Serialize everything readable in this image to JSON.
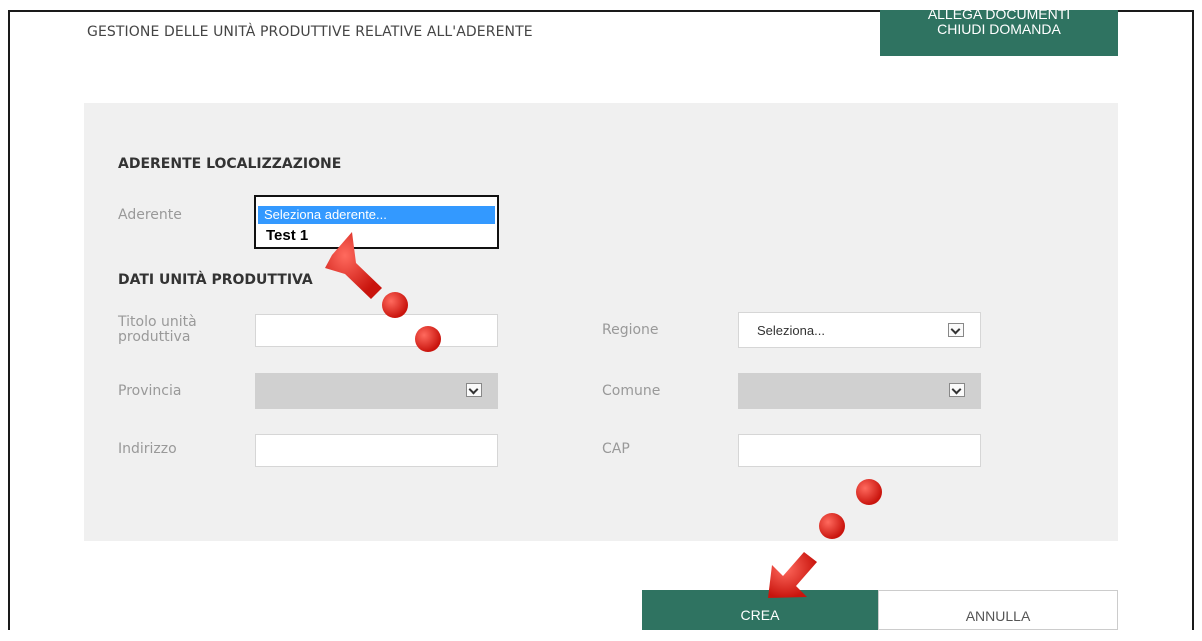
{
  "header": {
    "page_title": "GESTIONE DELLE UNITÀ PRODUTTIVE RELATIVE ALL'ADERENTE",
    "actions_line1": "ALLEGA DOCUMENTI",
    "actions_line2": "CHIUDI DOMANDA"
  },
  "aderente_section": {
    "title": "ADERENTE LOCALIZZAZIONE",
    "aderente_label": "Aderente",
    "dropdown_options": [
      "Seleziona aderente...",
      "Test 1"
    ]
  },
  "dati_section": {
    "title": "DATI UNITÀ PRODUTTIVA",
    "titolo_label_line1": "Titolo unità",
    "titolo_label_line2": "produttiva",
    "titolo_value": "",
    "provincia_label": "Provincia",
    "provincia_value": "",
    "indirizzo_label": "Indirizzo",
    "indirizzo_value": "",
    "regione_label": "Regione",
    "regione_value": "Seleziona...",
    "comune_label": "Comune",
    "comune_value": "",
    "cap_label": "CAP",
    "cap_value": ""
  },
  "footer": {
    "crea_label": "CREA",
    "annulla_label": "ANNULLA"
  },
  "annotation": {
    "arrow_color": "#e8221b"
  }
}
